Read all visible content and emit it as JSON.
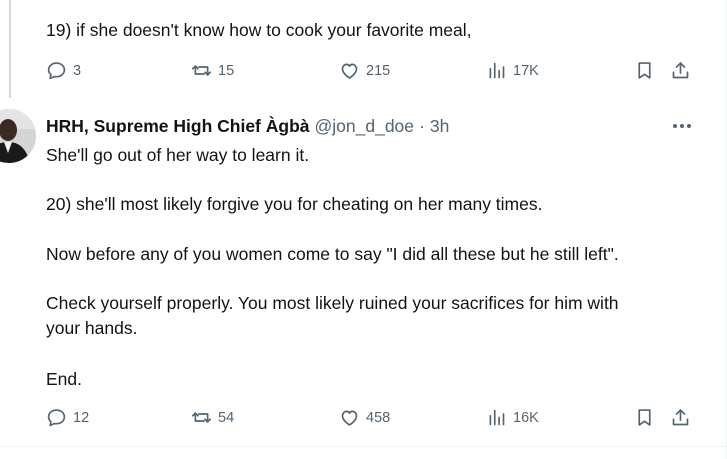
{
  "prev_tweet": {
    "text": "19) if she doesn't know how to cook your favorite meal,",
    "actions": {
      "replies": "3",
      "reposts": "15",
      "likes": "215",
      "views": "17K"
    }
  },
  "tweet": {
    "author_name": "HRH, Supreme High Chief Àgbà",
    "handle": "@jon_d_doe",
    "separator": "·",
    "time": "3h",
    "lines": [
      "She'll go out of her way to learn it.",
      "20) she'll most likely forgive you for cheating on her many times.",
      "Now before any of you women come to say \"I did all these but he still left\".",
      "Check yourself properly. You most likely ruined your sacrifices for him with",
      "your hands.",
      "End."
    ],
    "actions": {
      "replies": "12",
      "reposts": "54",
      "likes": "458",
      "views": "16K"
    }
  },
  "icons": {
    "reply": "reply-icon",
    "repost": "repost-icon",
    "like": "heart-icon",
    "views": "views-bar-chart-icon",
    "bookmark": "bookmark-icon",
    "share": "share-icon",
    "more": "more-dots-icon"
  },
  "colors": {
    "text": "#0f1419",
    "secondary": "#536471",
    "divider": "#eff3f4",
    "thread_line": "#cfd9de"
  }
}
